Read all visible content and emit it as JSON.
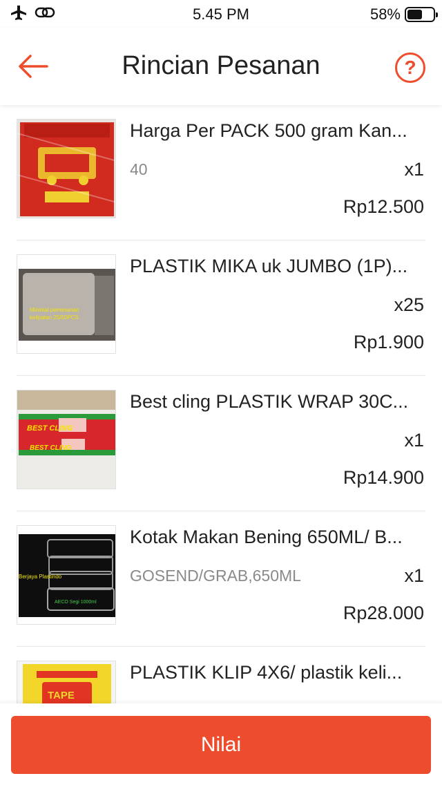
{
  "status_bar": {
    "time": "5.45 PM",
    "battery_text": "58%",
    "battery_level": 0.58,
    "left_icons": [
      "airplane-icon",
      "link-icon"
    ]
  },
  "header": {
    "title": "Rincian Pesanan",
    "back_icon": "arrow-left-icon",
    "help_icon": "question-circle-icon",
    "help_label": "?",
    "accent_color": "#ee4d2d"
  },
  "items": [
    {
      "name": "Harga Per PACK 500 gram Kan...",
      "variant": "40",
      "qty": "x1",
      "price": "Rp12.500"
    },
    {
      "name": "PLASTIK MIKA uk JUMBO (1P)...",
      "variant": "",
      "qty": "x25",
      "price": "Rp1.900",
      "thumb_text_1": "Minimal pemesanan",
      "thumb_text_2": "kelipatan 25/50PCS"
    },
    {
      "name": "Best cling PLASTIK WRAP 30C...",
      "variant": "",
      "qty": "x1",
      "price": "Rp14.900"
    },
    {
      "name": "Kotak Makan Bening 650ML/ B...",
      "variant": "GOSEND/GRAB,650ML",
      "qty": "x1",
      "price": "Rp28.000",
      "thumb_text_1": "Berjaya Plastindo",
      "thumb_text_2": "AECO Segi 1000ml"
    },
    {
      "name": "PLASTIK KLIP 4X6/ plastik keli...",
      "variant": "",
      "qty": "x1",
      "price": ""
    }
  ],
  "footer": {
    "button_label": "Nilai",
    "button_color": "#ee4d2d"
  }
}
